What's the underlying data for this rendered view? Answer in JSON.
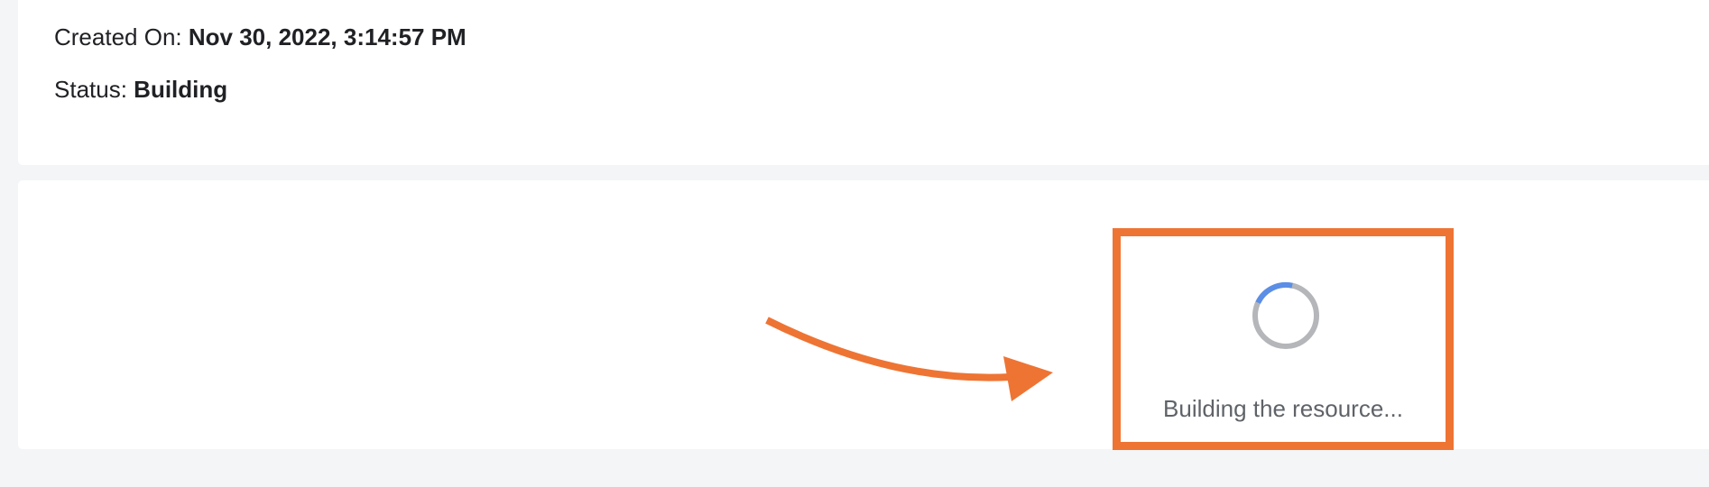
{
  "details": {
    "created_label": "Created On:",
    "created_value": "Nov 30, 2022, 3:14:57 PM",
    "status_label": "Status:",
    "status_value": "Building"
  },
  "build": {
    "message": "Building the resource...",
    "spinner_icon": "loading-spinner-icon"
  },
  "annotation": {
    "arrow_icon": "annotation-arrow-icon",
    "highlight_color": "#ee7434"
  },
  "colors": {
    "spinner_active": "#5b8ee6",
    "spinner_track": "#b4b6b9",
    "background": "#f4f5f6",
    "card": "#ffffff"
  }
}
